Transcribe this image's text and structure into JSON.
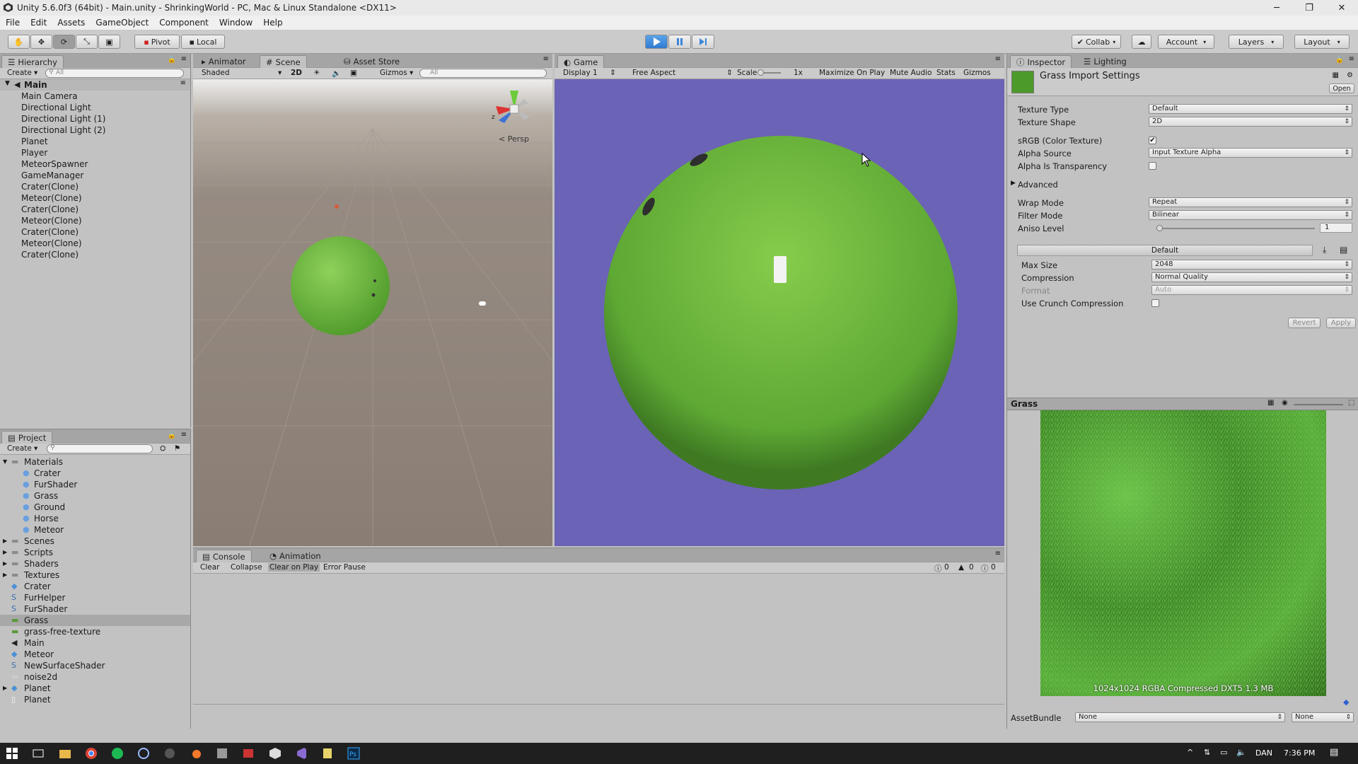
{
  "window": {
    "title": "Unity 5.6.0f3 (64bit) - Main.unity - ShrinkingWorld - PC, Mac & Linux Standalone <DX11>",
    "min": "─",
    "max": "❐",
    "close": "✕"
  },
  "menu": [
    "File",
    "Edit",
    "Assets",
    "GameObject",
    "Component",
    "Window",
    "Help"
  ],
  "toolbar": {
    "pivot": "Pivot",
    "local": "Local",
    "collab": "Collab",
    "account": "Account",
    "layers": "Layers",
    "layout": "Layout"
  },
  "hierarchy": {
    "tab": "Hierarchy",
    "create": "Create",
    "search": "All",
    "scene": "Main",
    "items": [
      "Main Camera",
      "Directional Light",
      "Directional Light (1)",
      "Directional Light (2)",
      "Planet",
      "Player",
      "MeteorSpawner",
      "GameManager",
      "Crater(Clone)",
      "Meteor(Clone)",
      "Crater(Clone)",
      "Meteor(Clone)",
      "Crater(Clone)",
      "Meteor(Clone)",
      "Crater(Clone)"
    ]
  },
  "scene": {
    "tab_animator": "Animator",
    "tab_scene": "Scene",
    "tab_store": "Asset Store",
    "shaded": "Shaded",
    "mode2d": "2D",
    "gizmos": "Gizmos",
    "search": "All",
    "persp": "< Persp"
  },
  "game": {
    "tab": "Game",
    "display": "Display 1",
    "aspect": "Free Aspect",
    "scale_label": "Scale",
    "scale_value": "1x",
    "maximize": "Maximize On Play",
    "mute": "Mute Audio",
    "stats": "Stats",
    "gizmos": "Gizmos"
  },
  "project": {
    "tab": "Project",
    "create": "Create",
    "items": [
      {
        "label": "Materials",
        "type": "folder",
        "level": 0,
        "open": true
      },
      {
        "label": "Crater",
        "type": "material",
        "level": 1
      },
      {
        "label": "FurShader",
        "type": "material",
        "level": 1
      },
      {
        "label": "Grass",
        "type": "material",
        "level": 1
      },
      {
        "label": "Ground",
        "type": "material",
        "level": 1
      },
      {
        "label": "Horse",
        "type": "material",
        "level": 1
      },
      {
        "label": "Meteor",
        "type": "material",
        "level": 1
      },
      {
        "label": "Scenes",
        "type": "folder",
        "level": 0
      },
      {
        "label": "Scripts",
        "type": "folder",
        "level": 0
      },
      {
        "label": "Shaders",
        "type": "folder",
        "level": 0
      },
      {
        "label": "Textures",
        "type": "folder",
        "level": 0
      },
      {
        "label": "Crater",
        "type": "prefab",
        "level": 0
      },
      {
        "label": "FurHelper",
        "type": "script",
        "level": 0
      },
      {
        "label": "FurShader",
        "type": "script",
        "level": 0
      },
      {
        "label": "Grass",
        "type": "texture",
        "level": 0,
        "selected": true
      },
      {
        "label": "grass-free-texture",
        "type": "texture",
        "level": 0
      },
      {
        "label": "Main",
        "type": "unity",
        "level": 0
      },
      {
        "label": "Meteor",
        "type": "prefab",
        "level": 0
      },
      {
        "label": "NewSurfaceShader",
        "type": "shader",
        "level": 0
      },
      {
        "label": "noise2d",
        "type": "noise",
        "level": 0
      },
      {
        "label": "Planet",
        "type": "prefab",
        "level": 0,
        "arrow": true
      },
      {
        "label": "Planet",
        "type": "file",
        "level": 0
      }
    ]
  },
  "console": {
    "tab": "Console",
    "tab_anim": "Animation",
    "clear": "Clear",
    "collapse": "Collapse",
    "clear_on_play": "Clear on Play",
    "error_pause": "Error Pause",
    "info_count": "0",
    "warn_count": "0",
    "error_count": "0"
  },
  "inspector": {
    "tab": "Inspector",
    "tab_lighting": "Lighting",
    "title": "Grass Import Settings",
    "open": "Open",
    "texture_type": {
      "label": "Texture Type",
      "value": "Default"
    },
    "texture_shape": {
      "label": "Texture Shape",
      "value": "2D"
    },
    "srgb": {
      "label": "sRGB (Color Texture)",
      "checked": true
    },
    "alpha_source": {
      "label": "Alpha Source",
      "value": "Input Texture Alpha"
    },
    "alpha_transparency": {
      "label": "Alpha Is Transparency",
      "checked": false
    },
    "advanced": "Advanced",
    "wrap_mode": {
      "label": "Wrap Mode",
      "value": "Repeat"
    },
    "filter_mode": {
      "label": "Filter Mode",
      "value": "Bilinear"
    },
    "aniso": {
      "label": "Aniso Level",
      "value": "1"
    },
    "platform_default": "Default",
    "max_size": {
      "label": "Max Size",
      "value": "2048"
    },
    "compression": {
      "label": "Compression",
      "value": "Normal Quality"
    },
    "format": {
      "label": "Format",
      "value": "Auto"
    },
    "crunch": {
      "label": "Use Crunch Compression",
      "checked": false
    },
    "revert": "Revert",
    "apply": "Apply",
    "preview_name": "Grass",
    "preview_info": "1024x1024  RGBA Compressed DXT5   1.3 MB",
    "assetbundle": "AssetBundle",
    "ab_name": "None",
    "ab_variant": "None"
  },
  "taskbar": {
    "lang": "DAN",
    "time": "7:36 PM"
  },
  "colors": {
    "game_bg": "#6b63b5",
    "grass": "#68b83c",
    "play_active": "#3c87d9"
  }
}
